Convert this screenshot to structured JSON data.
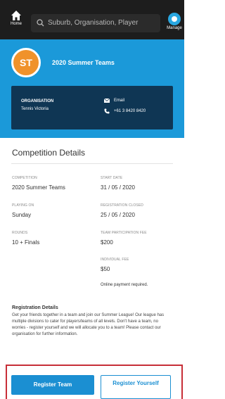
{
  "nav": {
    "home_label": "Home",
    "search_placeholder": "Suburb, Organisation, Player",
    "manage_label": "Manage"
  },
  "hero": {
    "avatar_initials": "ST",
    "team_name": "2020 Summer Teams",
    "org_label": "ORGANISATION",
    "org_name": "Tennis Victoria",
    "email_label": "Email",
    "phone": "+61 3 8420 8420"
  },
  "details": {
    "title": "Competition Details",
    "fields": [
      {
        "label": "COMPETITION",
        "value": "2020 Summer Teams"
      },
      {
        "label": "START DATE",
        "value": "31 / 05 / 2020"
      },
      {
        "label": "PLAYING ON",
        "value": "Sunday"
      },
      {
        "label": "REGISTRATION CLOSED",
        "value": "25 / 05 / 2020"
      },
      {
        "label": "ROUNDS",
        "value": "10 + Finals"
      },
      {
        "label": "TEAM PARTICIPATION FEE",
        "value": "$200"
      },
      {
        "label": "INDIVIDUAL FEE",
        "value": "$50"
      }
    ],
    "payment_note": "Online payment required."
  },
  "registration": {
    "title": "Registration Details",
    "body": "Get your friends together in a team and join our Summer League! Our league has multiple divisions to cater for players/teams of all levels. Don't have a team, no worries - register yourself and we will allocate you to a team! Please contact our organisation for further information."
  },
  "actions": {
    "register_team": "Register Team",
    "register_yourself": "Register Yourself"
  },
  "colors": {
    "topbar": "#1d1d1d",
    "hero": "#1b99d9",
    "org_card": "#0f3654",
    "avatar": "#f0922b",
    "primary_button": "#1b8fd2",
    "highlight_border": "#c72e37"
  }
}
